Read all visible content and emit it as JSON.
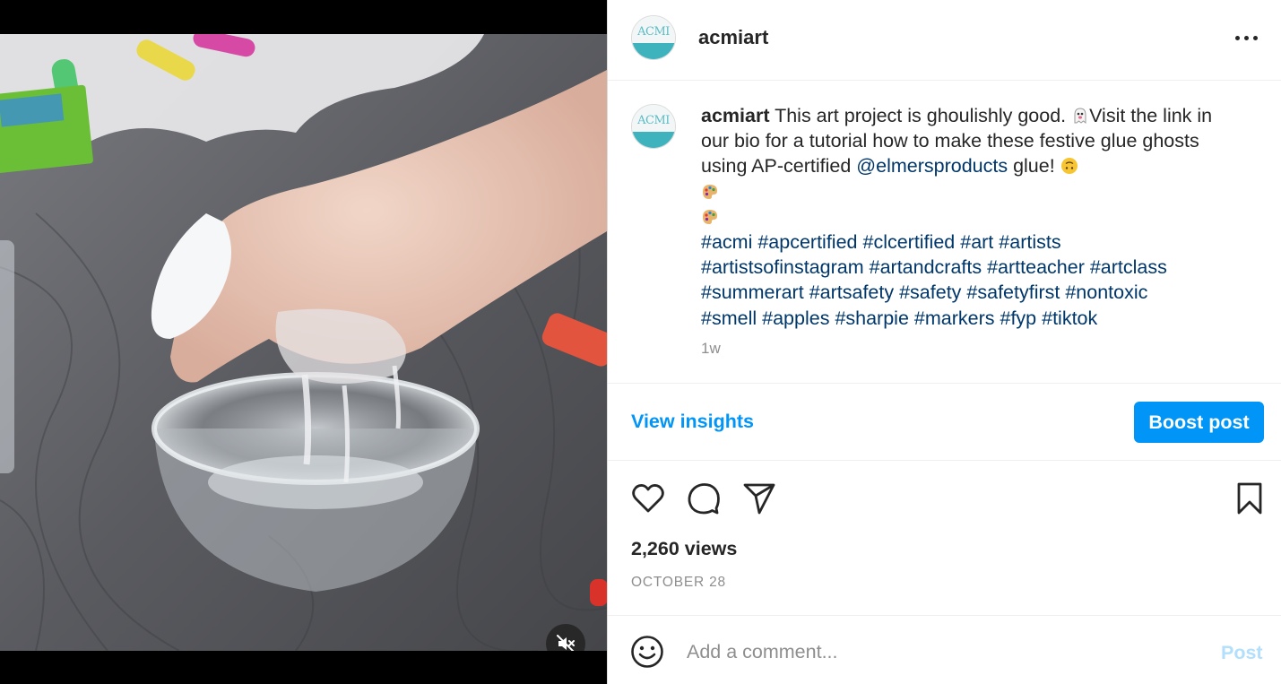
{
  "media": {
    "type": "video",
    "muted": true,
    "mute_icon": "speaker-muted-icon"
  },
  "header": {
    "username": "acmiart",
    "avatar_text": "ACMI",
    "more_icon": "more-horizontal-icon"
  },
  "caption": {
    "username": "acmiart",
    "text_part1": " This art project is ghoulishly good. ",
    "text_part2": "Visit the link in our bio for a tutorial how to make these festive glue ghosts using AP-certified ",
    "mention": "@elmersproducts",
    "text_part3": " glue! ",
    "emojis": [
      "ghost-emoji",
      "upside-down-face-emoji",
      "artist-palette-emoji",
      "artist-palette-emoji"
    ],
    "hashtags": [
      "#acmi",
      "#apcertified",
      "#clcertified",
      "#art",
      "#artists",
      "#artistsofinstagram",
      "#artandcrafts",
      "#artteacher",
      "#artclass",
      "#summerart",
      "#artsafety",
      "#safety",
      "#safetyfirst",
      "#nontoxic",
      "#smell",
      "#apples",
      "#sharpie",
      "#markers",
      "#fyp",
      "#tiktok"
    ],
    "time_ago": "1w"
  },
  "insights": {
    "view_insights_label": "View insights",
    "boost_label": "Boost post"
  },
  "actions": {
    "icons": [
      "heart-icon",
      "comment-icon",
      "share-icon",
      "bookmark-icon"
    ],
    "views": "2,260 views",
    "date": "OCTOBER 28"
  },
  "comment": {
    "placeholder": "Add a comment...",
    "post_label": "Post",
    "emoji_icon": "smiley-icon"
  },
  "colors": {
    "link": "#00376b",
    "accent": "#0095f6",
    "muted_text": "#8e8e8e",
    "post_disabled": "#b2dffc"
  }
}
